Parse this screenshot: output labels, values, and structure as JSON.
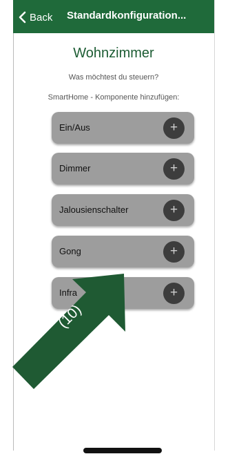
{
  "nav": {
    "back_label": "Back",
    "title": "Standardkonfiguration..."
  },
  "content": {
    "room_title": "Wohnzimmer",
    "subtitle": "Was möchtest du steuern?",
    "add_label": "SmartHome - Komponente hinzufügen:"
  },
  "components": [
    {
      "label": "Ein/Aus",
      "action_glyph": "+"
    },
    {
      "label": "Dimmer",
      "action_glyph": "+"
    },
    {
      "label": "Jalousienschalter",
      "action_glyph": "+"
    },
    {
      "label": "Gong",
      "action_glyph": "+"
    },
    {
      "label": "Infra",
      "action_glyph": "+"
    }
  ],
  "annotation": {
    "label": "(10)"
  },
  "colors": {
    "nav_background": "#1f6a3a",
    "title_color": "#1c5c33",
    "button_background": "#9d9d9d",
    "plus_background": "#3d3d3d",
    "callout_arrow": "#1f5a33"
  }
}
